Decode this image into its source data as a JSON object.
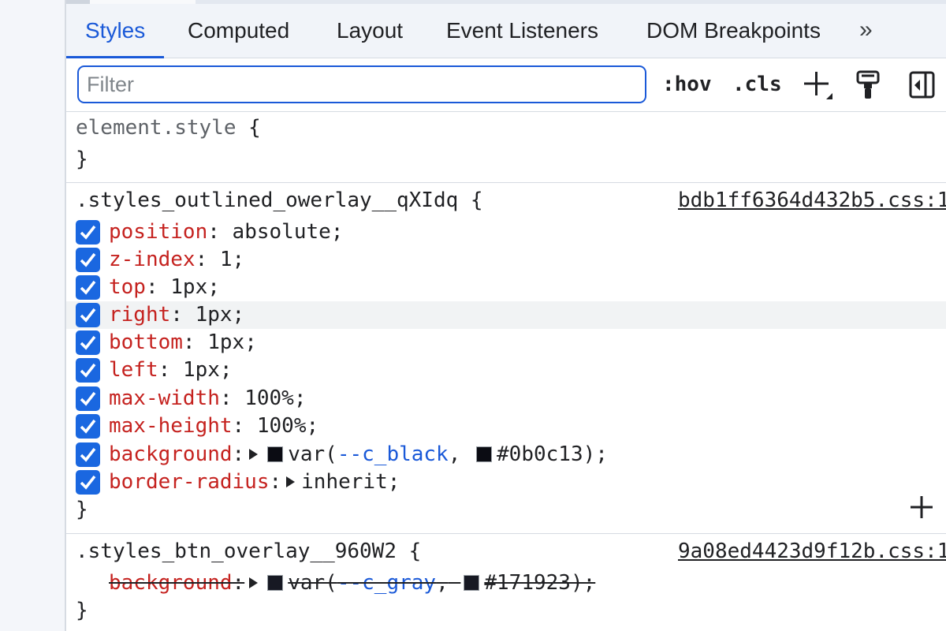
{
  "tabs": [
    {
      "label": "Styles",
      "active": true
    },
    {
      "label": "Computed",
      "active": false
    },
    {
      "label": "Layout",
      "active": false
    },
    {
      "label": "Event Listeners",
      "active": false
    },
    {
      "label": "DOM Breakpoints",
      "active": false
    }
  ],
  "more_tabs_label": "»",
  "toolbar": {
    "filter_placeholder": "Filter",
    "hov_label": ":hov",
    "cls_label": ".cls",
    "new_rule_icon": "plus-icon",
    "paint_icon": "paint-roller-icon",
    "sidebar_icon": "toggle-sidebar-icon"
  },
  "element_style": {
    "selector": "element.style",
    "open": "{",
    "close": "}"
  },
  "rule1": {
    "selector": ".styles_outlined_owerlay__qXIdq",
    "open": "{",
    "close": "}",
    "source": "bdb1ff6364d432b5.css:1",
    "declarations": [
      {
        "prop": "position",
        "value": "absolute;"
      },
      {
        "prop": "z-index",
        "value": "1;"
      },
      {
        "prop": "top",
        "value": "1px;"
      },
      {
        "prop": "right",
        "value": "1px;"
      },
      {
        "prop": "bottom",
        "value": "1px;"
      },
      {
        "prop": "left",
        "value": "1px;"
      },
      {
        "prop": "max-width",
        "value": "100%;"
      },
      {
        "prop": "max-height",
        "value": "100%;"
      },
      {
        "prop": "background",
        "var_open": "var(",
        "var_name": "--c_black",
        "var_sep": ",",
        "fallback": "#0b0c13);"
      },
      {
        "prop": "border-radius",
        "value": "inherit;"
      }
    ],
    "add_label": "+"
  },
  "rule2": {
    "selector": ".styles_btn_overlay__960W2",
    "open": "{",
    "close": "}",
    "source": "9a08ed4423d9f12b.css:1",
    "declaration": {
      "prop": "background",
      "var_open": "var(",
      "var_name": "--c_gray",
      "var_sep": ",",
      "fallback": "#171923);"
    }
  },
  "colors": {
    "accent": "#1a59d8",
    "property": "#c5221f",
    "swatch_black": "#0b0c13",
    "swatch_gray": "#171923"
  }
}
